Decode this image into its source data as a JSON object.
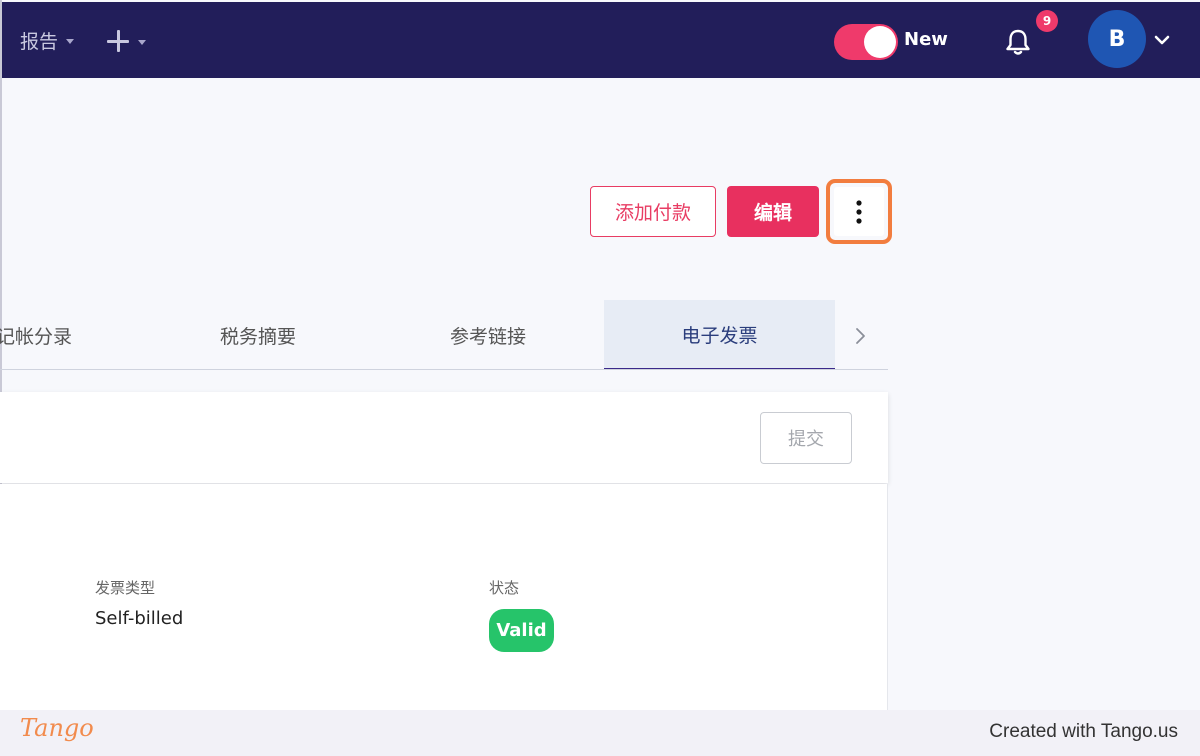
{
  "topbar": {
    "reports_label": "报告",
    "toggle_label": "New",
    "notification_count": "9",
    "avatar_initial": "B",
    "colors": {
      "background": "#221e5a",
      "accent": "#ef3a6b",
      "avatar": "#1f56b3"
    }
  },
  "actions": {
    "add_payment_label": "添加付款",
    "edit_label": "编辑",
    "more_icon": "vertical-ellipsis-icon"
  },
  "tabs": [
    {
      "label": "记帐分录",
      "active": false
    },
    {
      "label": "税务摘要",
      "active": false
    },
    {
      "label": "参考链接",
      "active": false
    },
    {
      "label": "电子发票",
      "active": true
    }
  ],
  "einvoice": {
    "submit_label": "提交",
    "invoice_type_label": "发票类型",
    "invoice_type_value": "Self-billed",
    "status_label": "状态",
    "status_value": "Valid",
    "status_color": "#26c46a"
  },
  "footer": {
    "brand": "Tango",
    "credit": "Created with Tango.us"
  }
}
